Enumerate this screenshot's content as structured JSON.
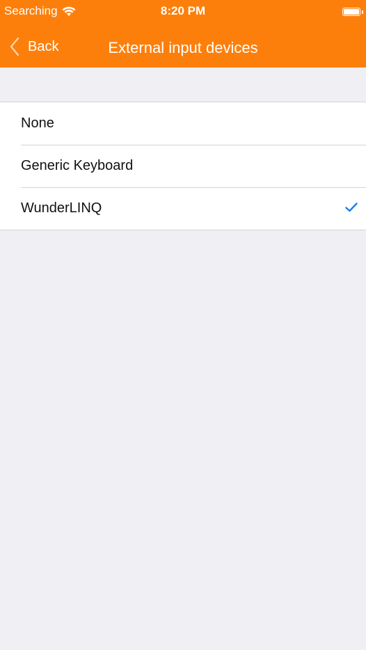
{
  "status_bar": {
    "carrier": "Searching",
    "time": "8:20 PM"
  },
  "nav": {
    "back_label": "Back",
    "title": "External input devices"
  },
  "options": [
    {
      "label": "None",
      "selected": false
    },
    {
      "label": "Generic Keyboard",
      "selected": false
    },
    {
      "label": "WunderLINQ",
      "selected": true
    }
  ],
  "colors": {
    "accent": "#fd7f0b",
    "checkmark": "#1a7cf0",
    "background": "#efeff4"
  },
  "icons": [
    "wifi-icon",
    "battery-icon",
    "back-chevron-icon",
    "checkmark-icon"
  ]
}
